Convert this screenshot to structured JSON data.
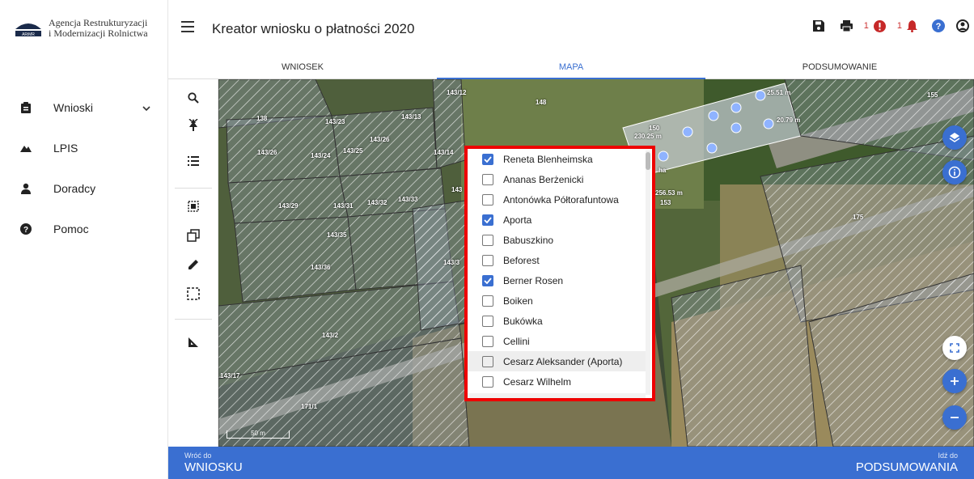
{
  "logo": {
    "line1": "Agencja Restrukturyzacji",
    "line2": "i Modernizacji Rolnictwa",
    "mark_text": "ARiMR"
  },
  "sidebar": {
    "items": [
      {
        "label": "Wnioski",
        "icon": "clipboard-icon"
      },
      {
        "label": "LPIS",
        "icon": "mountains-icon"
      },
      {
        "label": "Doradcy",
        "icon": "person-icon"
      },
      {
        "label": "Pomoc",
        "icon": "help-circle-icon"
      }
    ]
  },
  "header": {
    "title": "Kreator wniosku o płatności 2020",
    "errors_count": "1",
    "notifications_count": "1"
  },
  "tabs": [
    {
      "label": "WNIOSEK"
    },
    {
      "label": "MAPA"
    },
    {
      "label": "PODSUMOWANIE"
    }
  ],
  "map_labels": [
    "143/12",
    "148",
    "138",
    "143/23",
    "143/13",
    "150",
    "155",
    "143/26",
    "143/26",
    "143/24",
    "143/25",
    "143/14",
    "143/33",
    "143/29",
    "143/31",
    "143/32",
    "153",
    "175",
    "143/35",
    "143/36",
    "143/3",
    "143/2",
    "143/17",
    "171/1",
    "143"
  ],
  "measurements": [
    "25.51 m",
    "20.79 m",
    "230.25 m",
    "256.53 m",
    "ha"
  ],
  "scale_label": "50 m",
  "dropdown": {
    "items": [
      {
        "label": "Reneta Blenheimska",
        "checked": true
      },
      {
        "label": "Ananas Berżenicki",
        "checked": false
      },
      {
        "label": "Antonówka Półtorafuntowa",
        "checked": false
      },
      {
        "label": "Aporta",
        "checked": true
      },
      {
        "label": "Babuszkino",
        "checked": false
      },
      {
        "label": "Beforest",
        "checked": false
      },
      {
        "label": "Berner Rosen",
        "checked": true
      },
      {
        "label": "Boiken",
        "checked": false
      },
      {
        "label": "Bukówka",
        "checked": false
      },
      {
        "label": "Cellini",
        "checked": false
      },
      {
        "label": "Cesarz Aleksander (Aporta)",
        "checked": false
      },
      {
        "label": "Cesarz Wilhelm",
        "checked": false
      }
    ]
  },
  "footer": {
    "back_small": "Wróć do",
    "back_big": "WNIOSKU",
    "next_small": "Idź do",
    "next_big": "PODSUMOWANIA"
  },
  "colors": {
    "accent": "#3a6fd1",
    "highlight": "#e00000",
    "alert": "#c62828"
  }
}
